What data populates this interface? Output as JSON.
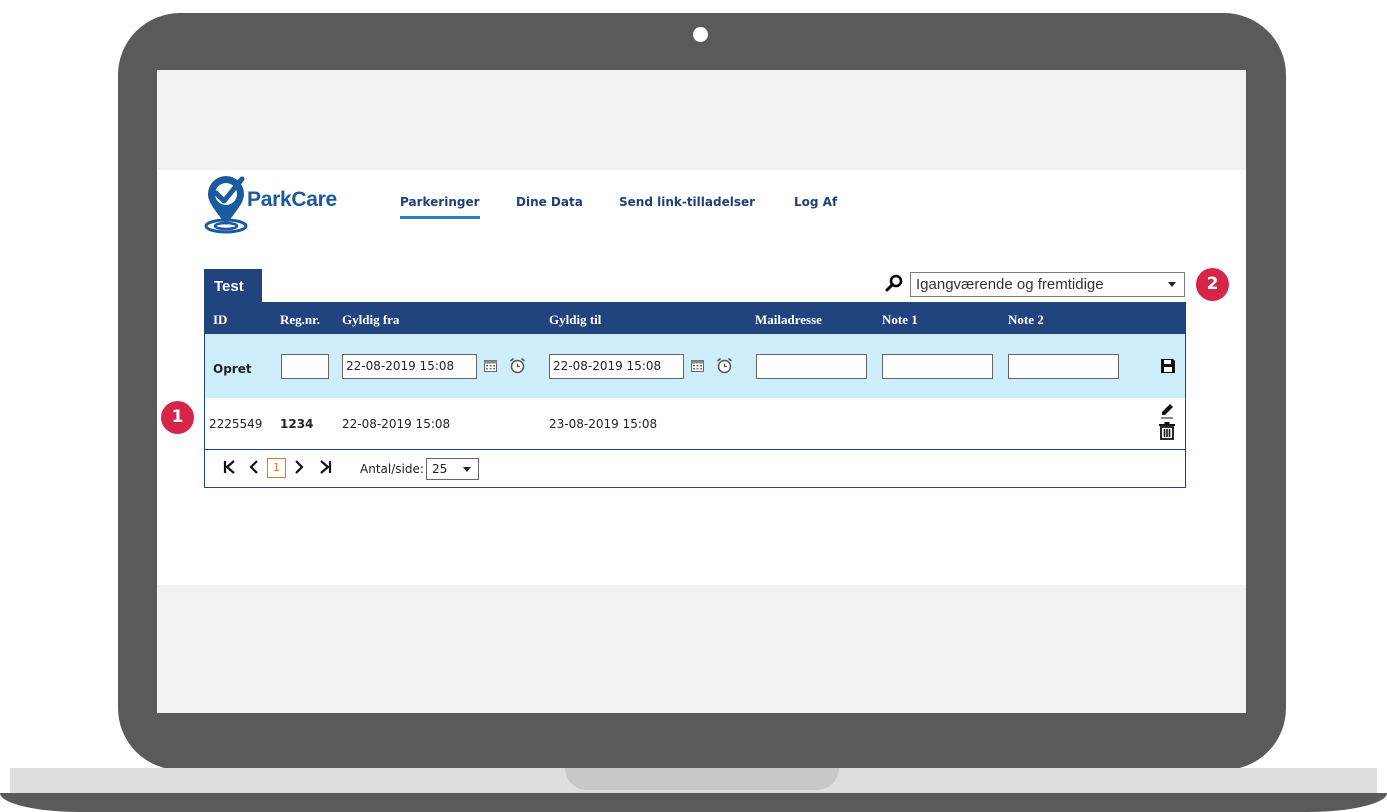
{
  "app": {
    "brand": "ParkCare",
    "nav": [
      "Parkeringer",
      "Dine Data",
      "Send link-tilladelser",
      "Log Af"
    ],
    "active_nav": "Parkeringer"
  },
  "tab": {
    "label": "Test"
  },
  "filter": {
    "selected": "Igangværende og fremtidige"
  },
  "callouts": [
    "1",
    "2"
  ],
  "grid": {
    "columns": {
      "id": "ID",
      "reg": "Reg.nr.",
      "from": "Gyldig fra",
      "to": "Gyldig til",
      "mail": "Mailadresse",
      "note1": "Note 1",
      "note2": "Note 2"
    },
    "create_row": {
      "label": "Opret",
      "reg_value": "",
      "from_value": "22-08-2019 15:08",
      "to_value": "22-08-2019 15:08",
      "mail_value": "",
      "note1_value": "",
      "note2_value": ""
    },
    "rows": [
      {
        "id": "2225549",
        "reg": "1234",
        "from": "22-08-2019 15:08",
        "to": "23-08-2019 15:08",
        "mail": "",
        "note1": "",
        "note2": ""
      }
    ]
  },
  "pager": {
    "current_page": "1",
    "per_page_label": "Antal/side:",
    "per_page_value": "25"
  },
  "colors": {
    "brand_blue": "#1a5aa0",
    "header_navy": "#21447f",
    "create_row_bg": "#cdeefa",
    "callout_red": "#d62648",
    "pager_orange": "#e07a1f",
    "nav_underline": "#2b7ec9"
  },
  "icons": [
    "logo-pin-icon",
    "search-icon",
    "calendar-icon",
    "alarm-clock-icon",
    "save-icon",
    "edit-icon",
    "delete-icon",
    "first-page-icon",
    "prev-page-icon",
    "next-page-icon",
    "last-page-icon",
    "chevron-down-icon"
  ]
}
